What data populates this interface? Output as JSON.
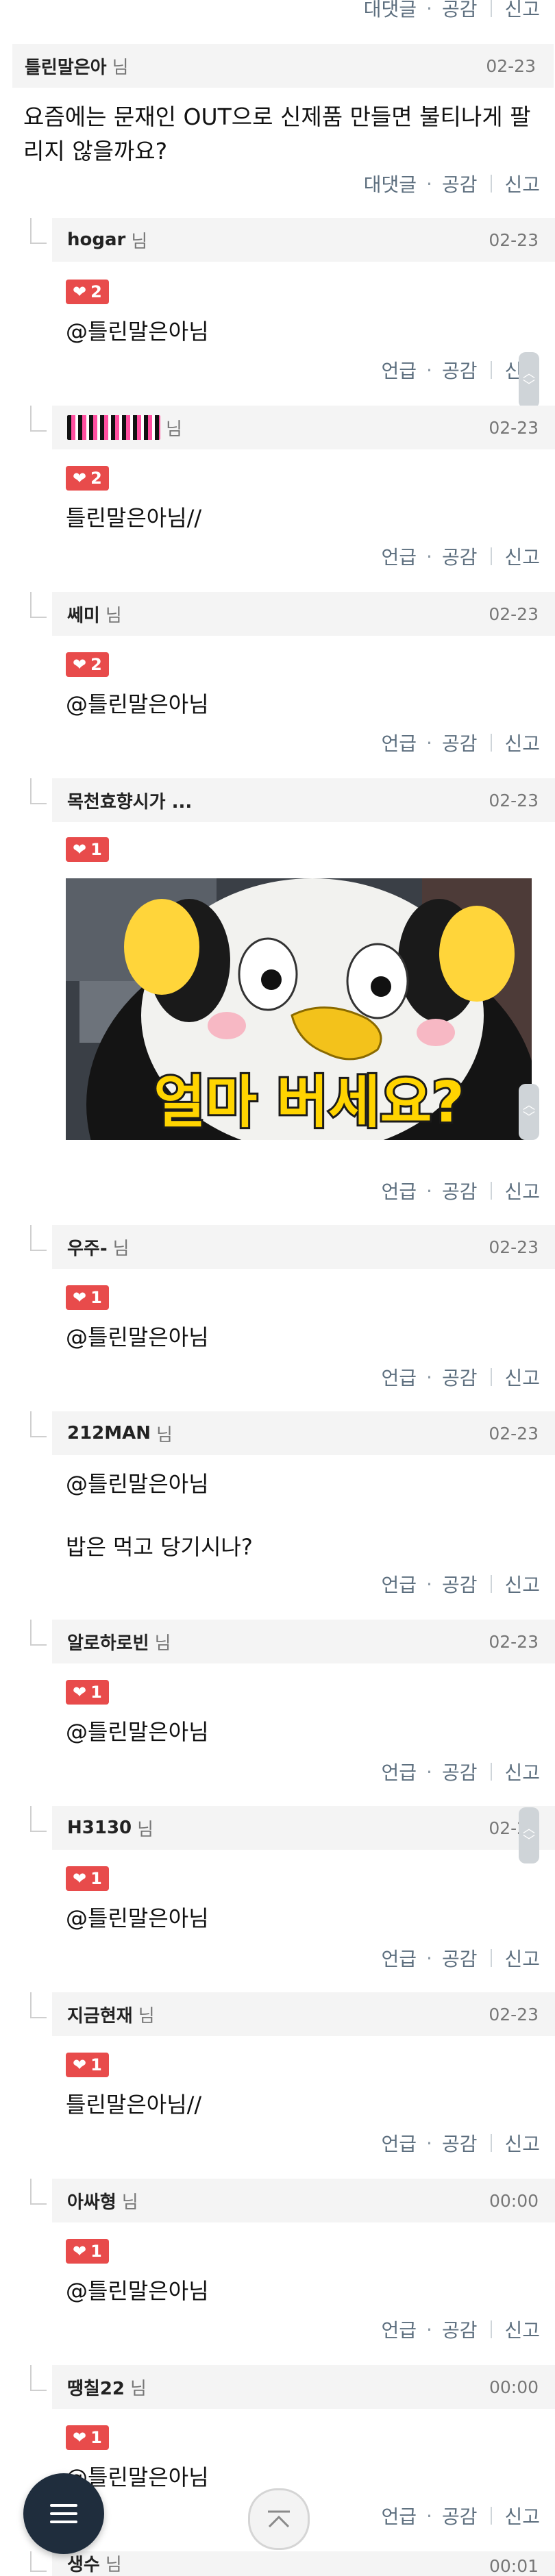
{
  "actions": {
    "reply": "대댓글",
    "mention": "언급",
    "like": "공감",
    "report": "신고",
    "dot": "·"
  },
  "top_actions": {
    "reply": "대댓글",
    "like": "공감",
    "report": "신고"
  },
  "main_comment": {
    "author": "틀린말은아",
    "suffix": "님",
    "date": "02-23",
    "text": "요즘에는 문재인 OUT으로 신제품 만들면 불티나게 팔리지 않을까요?"
  },
  "replies": [
    {
      "author": "hogar",
      "suffix": "님",
      "date": "02-23",
      "likes": "2",
      "lines": [
        "@틀린말은아님"
      ]
    },
    {
      "author": "",
      "suffix": "님",
      "date": "02-23",
      "likes": "2",
      "lines": [
        "틀린말은아님//"
      ]
    },
    {
      "author": "쎄미",
      "suffix": "님",
      "date": "02-23",
      "likes": "2",
      "lines": [
        "@틀린말은아님"
      ]
    },
    {
      "author": "목천효향시가 ...",
      "suffix": "",
      "date": "02-23",
      "likes": "1",
      "lines": [],
      "image_caption": "얼마 버세요?"
    },
    {
      "author": "우주-",
      "suffix": "님",
      "date": "02-23",
      "likes": "1",
      "lines": [
        "@틀린말은아님"
      ]
    },
    {
      "author": "212MAN",
      "suffix": "님",
      "date": "02-23",
      "likes": "",
      "lines": [
        "@틀린말은아님",
        "밥은 먹고 당기시나?"
      ]
    },
    {
      "author": "알로하로빈",
      "suffix": "님",
      "date": "02-23",
      "likes": "1",
      "lines": [
        "@틀린말은아님"
      ]
    },
    {
      "author": "H3130",
      "suffix": "님",
      "date": "02-23",
      "likes": "1",
      "lines": [
        "@틀린말은아님"
      ]
    },
    {
      "author": "지금현재",
      "suffix": "님",
      "date": "02-23",
      "likes": "1",
      "lines": [
        "틀린말은아님//"
      ]
    },
    {
      "author": "아싸형",
      "suffix": "님",
      "date": "00:00",
      "likes": "1",
      "lines": [
        "@틀린말은아님"
      ]
    },
    {
      "author": "땡칠22",
      "suffix": "님",
      "date": "00:00",
      "likes": "1",
      "lines": [
        "@틀린말은아님"
      ]
    },
    {
      "author": "생수",
      "suffix": "님",
      "date": "00:01",
      "likes": "",
      "lines": []
    }
  ],
  "fab": {
    "icon": "hamburger-menu-icon"
  },
  "scroll_top": {
    "icon": "chevron-up-icon"
  },
  "colors": {
    "like_badge": "#e84b4b",
    "header_bg": "#f4f4f4",
    "action_text": "#5c6e7e",
    "fab_bg": "#1f2d3d"
  }
}
